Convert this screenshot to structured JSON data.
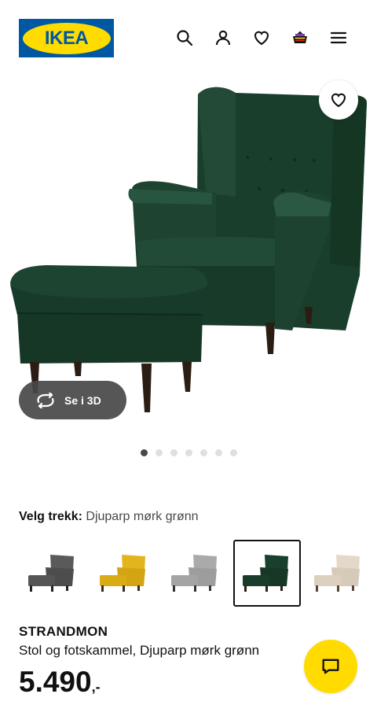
{
  "header": {
    "logo_text": "IKEA",
    "icons": [
      "search-icon",
      "user-icon",
      "heart-icon",
      "basket-icon",
      "menu-icon"
    ]
  },
  "hero": {
    "view_3d_label": "Se i 3D",
    "image_count": 7,
    "active_image": 1
  },
  "color_select": {
    "label": "Velg trekk:",
    "value": "Djuparp mørk grønn",
    "options": [
      {
        "color": "#5a5a5a"
      },
      {
        "color": "#e2b51c"
      },
      {
        "color": "#a9a9a9"
      },
      {
        "color": "#173b2a",
        "selected": true
      },
      {
        "color": "#e3d8c9"
      }
    ]
  },
  "product": {
    "name": "STRANDMON",
    "description": "Stol og fotskammel, Djuparp mørk grønn",
    "price_main": "5.490",
    "price_suffix": ",-"
  },
  "colors": {
    "brand_blue": "#0058a3",
    "brand_yellow": "#ffdb00",
    "chair_green": "#1b3f2d"
  }
}
